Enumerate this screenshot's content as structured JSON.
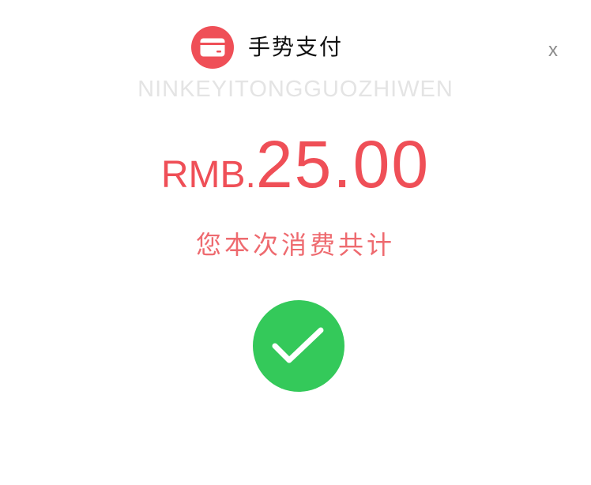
{
  "header": {
    "title": "手势支付",
    "close_label": "x",
    "pay_icon": "payment-card-icon"
  },
  "subtitle": "NINKEYITONGGUOZHIWEN",
  "amount": {
    "currency": "RMB.",
    "value": "25.00"
  },
  "caption": "您本次消费共计",
  "status": {
    "icon": "success-check-icon"
  },
  "colors": {
    "accent": "#ef4f57",
    "success": "#34c95a",
    "subtitle": "#e4e4e4",
    "close": "#8c8c8c"
  }
}
